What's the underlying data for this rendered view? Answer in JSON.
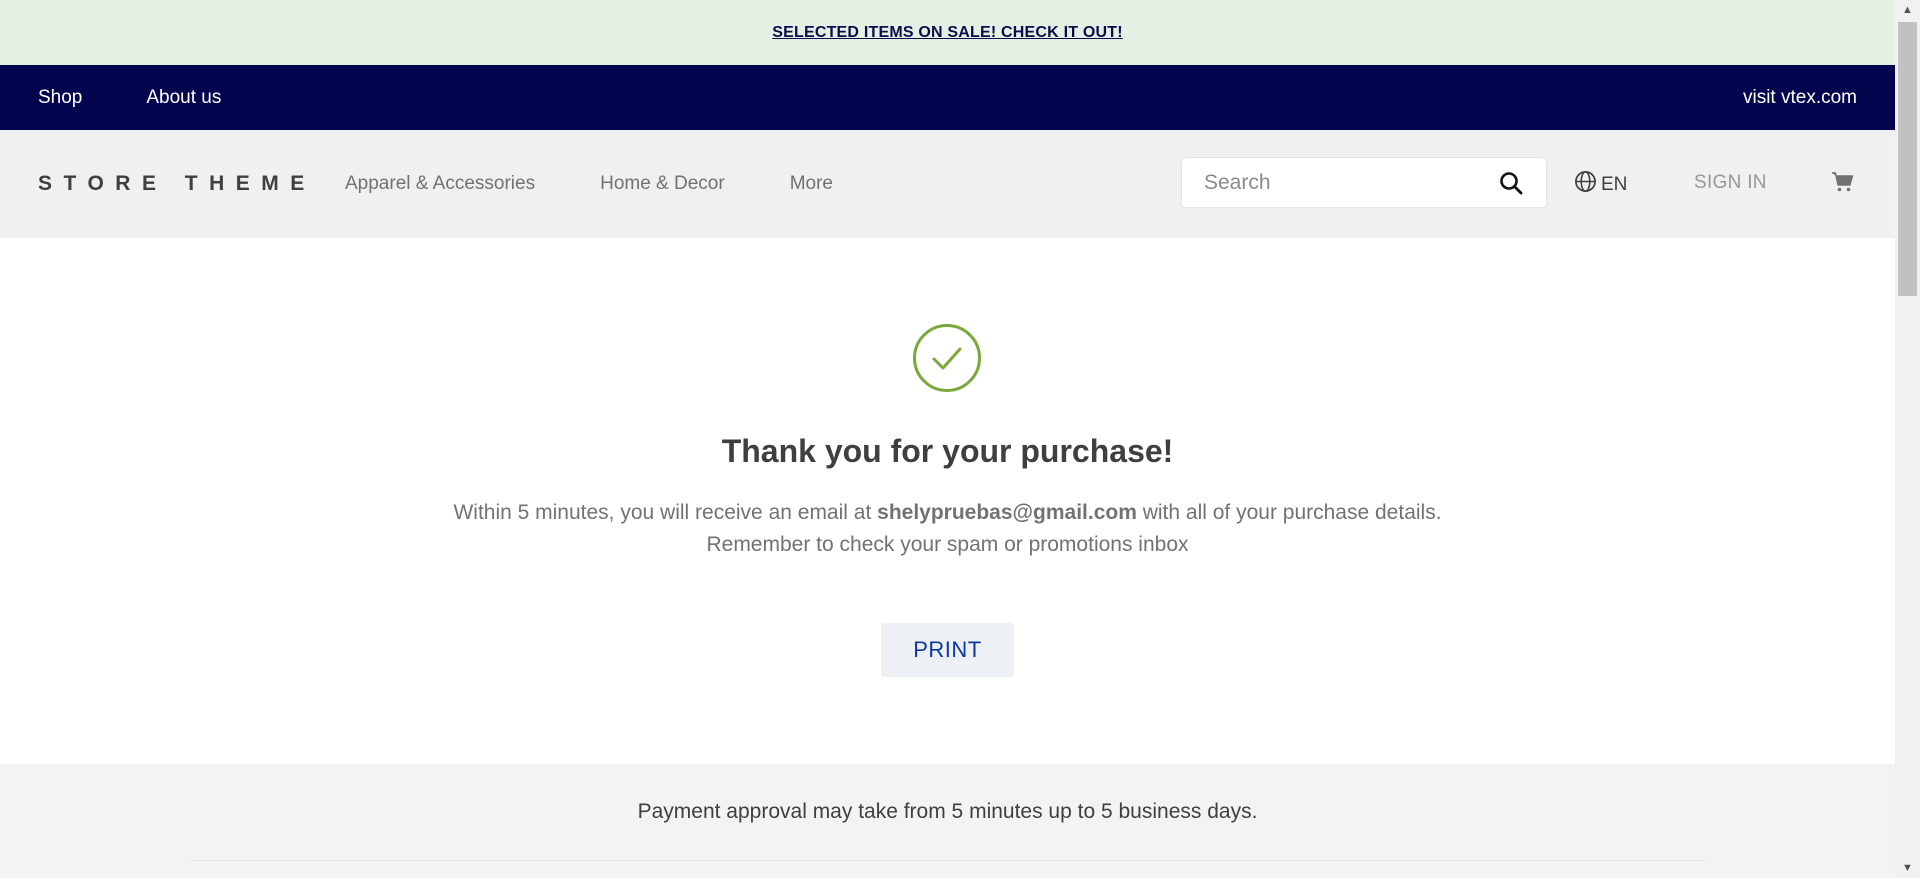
{
  "promo": {
    "text": "SELECTED ITEMS ON SALE! CHECK IT OUT!"
  },
  "top_nav": {
    "items": [
      {
        "label": "Shop"
      },
      {
        "label": "About us"
      }
    ],
    "right_link": "visit vtex.com"
  },
  "header": {
    "logo": "STORE THEME",
    "menu": [
      {
        "label": "Apparel & Accessories"
      },
      {
        "label": "Home & Decor"
      },
      {
        "label": "More"
      }
    ],
    "search": {
      "placeholder": "Search",
      "value": ""
    },
    "language": "EN",
    "sign_in": "SIGN IN"
  },
  "confirmation": {
    "title": "Thank you for your purchase!",
    "message_prefix": "Within 5 minutes, you will receive an email at",
    "email": "shelypruebas@gmail.com",
    "message_suffix": "with all of your purchase details.",
    "message_line2": "Remember to check your spam or promotions inbox",
    "print_label": "PRINT"
  },
  "payment_note": "Payment approval may take from 5 minutes up to 5 business days.",
  "colors": {
    "promo_bg": "#e5efe4",
    "nav_bg": "#03044e",
    "header_bg": "#f0f0f0",
    "success_green": "#79a83b",
    "print_text": "#0c389f"
  },
  "icons": {
    "search": "search-icon",
    "language": "globe-icon",
    "cart": "cart-icon",
    "success": "check-circle-icon"
  }
}
